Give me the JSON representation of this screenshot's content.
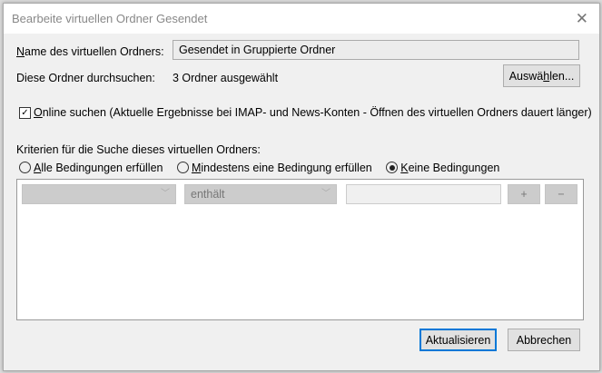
{
  "window": {
    "title": "Bearbeite virtuellen Ordner Gesendet"
  },
  "name_label_u": "N",
  "name_label_rest": "ame des virtuellen Ordners:",
  "name_value": "Gesendet in Gruppierte Ordner",
  "folders_label": "Diese Ordner durchsuchen:",
  "folders_value": "3 Ordner ausgewählt",
  "choose_a": "Auswä",
  "choose_u": "h",
  "choose_b": "len...",
  "online": {
    "checked": true,
    "u": "O",
    "rest": "nline suchen (Aktuelle Ergebnisse bei IMAP- und News-Konten - Öffnen des virtuellen Ordners dauert länger)"
  },
  "criteria_label": "Kriterien für die Suche dieses virtuellen Ordners:",
  "radios": [
    {
      "u": "A",
      "rest": "lle Bedingungen erfüllen",
      "selected": false
    },
    {
      "u": "M",
      "rest": "indestens eine Bedingung erfüllen",
      "selected": false
    },
    {
      "u": "K",
      "rest": "eine Bedingungen",
      "selected": true
    }
  ],
  "rule": {
    "field": "",
    "operator": "enthält",
    "value": "",
    "add": "+",
    "remove": "−"
  },
  "buttons": {
    "update": "Aktualisieren",
    "cancel": "Abbrechen"
  }
}
